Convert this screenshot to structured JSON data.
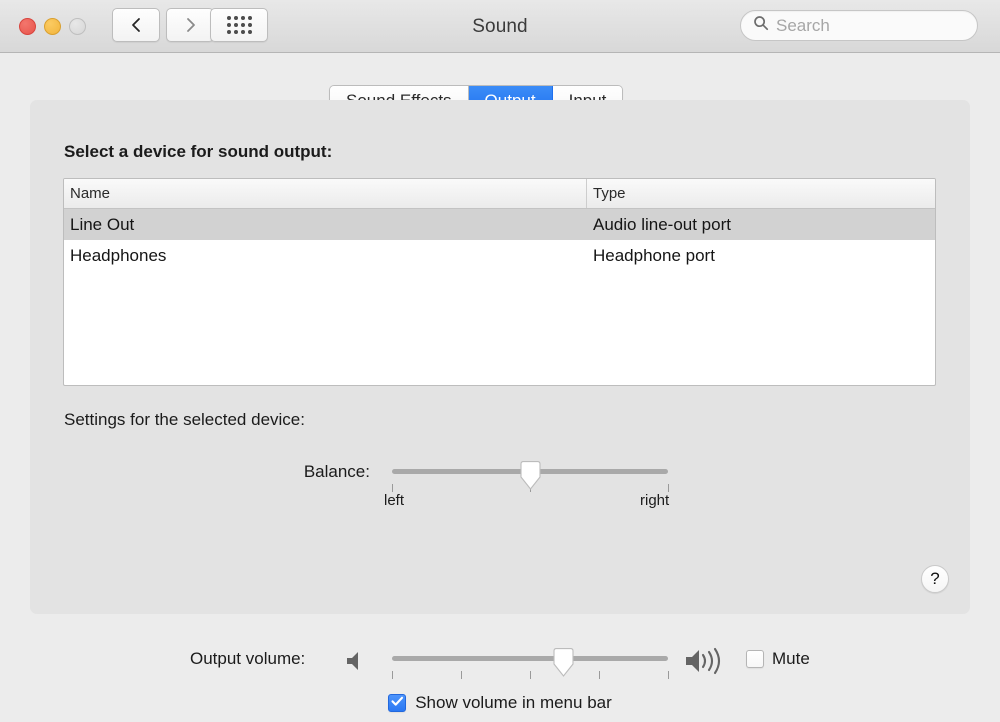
{
  "window": {
    "title": "Sound",
    "traffic_lights": [
      {
        "name": "close-button",
        "color": "#e8544b"
      },
      {
        "name": "minimize-button",
        "color": "#f2b43c"
      },
      {
        "name": "zoom-button",
        "color": "#d6d6d6"
      }
    ],
    "nav": {
      "back_icon": "chevron-left-icon",
      "forward_icon": "chevron-right-icon",
      "grid_icon": "show-all-grid-icon"
    },
    "search": {
      "icon": "search-icon",
      "placeholder": "Search",
      "value": ""
    }
  },
  "tabs": [
    {
      "label": "Sound Effects",
      "selected": false
    },
    {
      "label": "Output",
      "selected": true
    },
    {
      "label": "Input",
      "selected": false
    }
  ],
  "panel": {
    "section_title": "Select a device for sound output:",
    "settings_title": "Settings for the selected device:",
    "help_label": "?"
  },
  "device_table": {
    "columns": [
      "Name",
      "Type"
    ],
    "rows": [
      {
        "name": "Line Out",
        "type": "Audio line-out port",
        "selected": true
      },
      {
        "name": "Headphones",
        "type": "Headphone port",
        "selected": false
      }
    ]
  },
  "balance": {
    "label": "Balance:",
    "value_percent": 50,
    "tick_labels": {
      "left": "left",
      "right": "right"
    },
    "ticks_percent": [
      0,
      50,
      100
    ]
  },
  "output_volume": {
    "label": "Output volume:",
    "value_percent": 62,
    "ticks_percent": [
      0,
      25,
      50,
      75,
      100
    ],
    "low_icon": "speaker-quiet-icon",
    "high_icon": "speaker-loud-icon",
    "mute": {
      "label": "Mute",
      "checked": false
    }
  },
  "show_volume_in_menu_bar": {
    "label": "Show volume in menu bar",
    "checked": true
  },
  "colors": {
    "accent_blue": "#2a78f3",
    "window_bg": "#ececec",
    "panel_bg": "#e3e3e3",
    "row_selected": "#d2d2d2",
    "track": "#a9a9a9"
  }
}
